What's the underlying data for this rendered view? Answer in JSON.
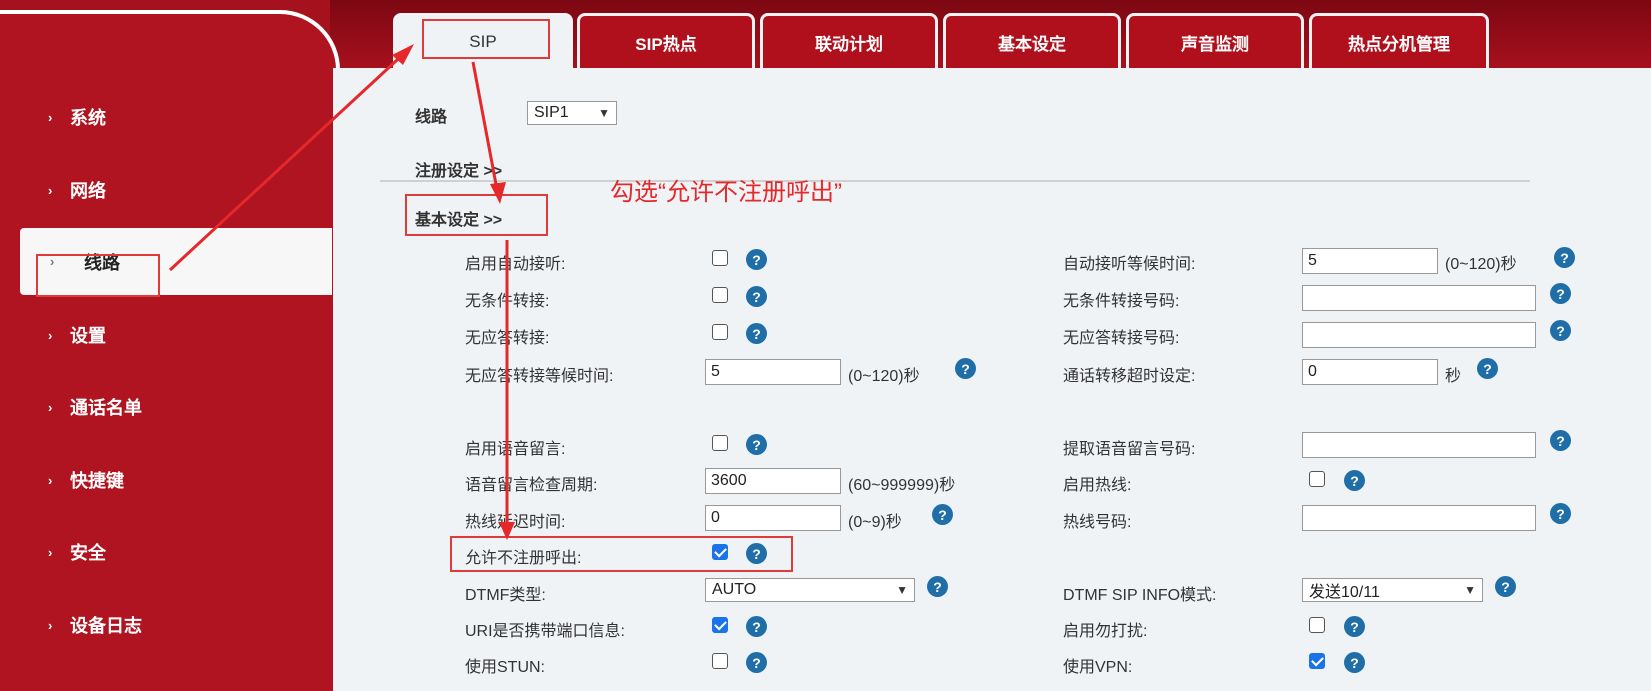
{
  "sidebar": {
    "items": [
      {
        "label": "系统"
      },
      {
        "label": "网络"
      },
      {
        "label": "线路"
      },
      {
        "label": "设置"
      },
      {
        "label": "通话名单"
      },
      {
        "label": "快捷键"
      },
      {
        "label": "安全"
      },
      {
        "label": "设备日志"
      }
    ],
    "active_index": 2
  },
  "tabs": [
    {
      "label": "SIP"
    },
    {
      "label": "SIP热点"
    },
    {
      "label": "联动计划"
    },
    {
      "label": "基本设定"
    },
    {
      "label": "声音监测"
    },
    {
      "label": "热点分机管理"
    }
  ],
  "line": {
    "label": "线路",
    "selected": "SIP1"
  },
  "sections": {
    "register": "注册设定 >>",
    "basic": "基本设定 >>"
  },
  "annotation": "勾选“允许不注册呼出”",
  "fields": {
    "auto_answer": {
      "label": "启用自动接听:",
      "checked": false
    },
    "auto_answer_wait": {
      "label": "自动接听等候时间:",
      "value": "5",
      "unit": "(0~120)秒"
    },
    "unconditional_forward": {
      "label": "无条件转接:",
      "checked": false
    },
    "unconditional_forward_number": {
      "label": "无条件转接号码:",
      "value": ""
    },
    "no_answer_forward": {
      "label": "无应答转接:",
      "checked": false
    },
    "no_answer_forward_number": {
      "label": "无应答转接号码:",
      "value": ""
    },
    "no_answer_forward_wait": {
      "label": "无应答转接等候时间:",
      "value": "5",
      "unit": "(0~120)秒"
    },
    "call_transfer_timeout": {
      "label": "通话转移超时设定:",
      "value": "0",
      "unit": "秒"
    },
    "voicemail": {
      "label": "启用语音留言:",
      "checked": false
    },
    "voicemail_number": {
      "label": "提取语音留言号码:",
      "value": ""
    },
    "voicemail_check": {
      "label": "语音留言检查周期:",
      "value": "3600",
      "unit": "(60~999999)秒"
    },
    "hotline": {
      "label": "启用热线:",
      "checked": false
    },
    "hotline_delay": {
      "label": "热线延迟时间:",
      "value": "0",
      "unit": "(0~9)秒"
    },
    "hotline_number": {
      "label": "热线号码:",
      "value": ""
    },
    "allow_unregistered": {
      "label": "允许不注册呼出:",
      "checked": true
    },
    "dtmf_type": {
      "label": "DTMF类型:",
      "selected": "AUTO"
    },
    "dtmf_sip_info": {
      "label": "DTMF SIP INFO模式:",
      "selected": "发送10/11"
    },
    "uri_port": {
      "label": "URI是否携带端口信息:",
      "checked": true
    },
    "dnd": {
      "label": "启用勿打扰:",
      "checked": false
    },
    "stun": {
      "label": "使用STUN:",
      "checked": false
    },
    "vpn": {
      "label": "使用VPN:",
      "checked": true
    }
  },
  "help_glyph": "?",
  "icons": {
    "nav_chevron": "chevron-right-icon",
    "select_arrow": "chevron-down-icon",
    "help": "help-icon"
  },
  "colors": {
    "brand_red": "#a5111d",
    "content_bg": "#f0f3f6",
    "annotation_red": "#e5282a",
    "checkbox_blue": "#1a73e8",
    "help_blue": "#1f6ea8"
  }
}
